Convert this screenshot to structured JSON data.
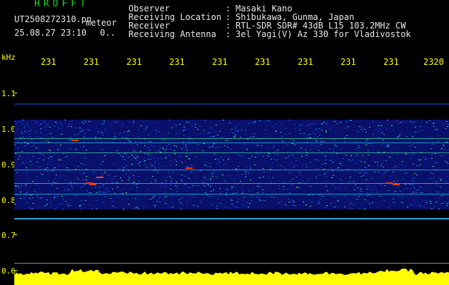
{
  "header": {
    "brand": "HROFFT",
    "filename": "UT2508272310.pn",
    "mode": "meteor",
    "datetime": "25.08.27 23:10",
    "counter": "0..",
    "info_rows": [
      {
        "key": "Observer",
        "value": "Masaki Kano"
      },
      {
        "key": "Receiving Location",
        "value": "Shibukawa, Gunma, Japan"
      },
      {
        "key": "Receiver",
        "value": "RTL-SDR SDR# 43dB L15 103.2MHz CW"
      },
      {
        "key": "Receiving Antenna",
        "value": "3el Yagi(V) Az 330 for Vladivostok"
      }
    ]
  },
  "axis": {
    "y_unit": "kHz",
    "y_ticks": [
      "1.1",
      "1.0",
      "0.9",
      "0.8",
      "0.7",
      "0.6"
    ],
    "x_ticks": [
      "231",
      "231",
      "231",
      "231",
      "231",
      "231",
      "231",
      "231",
      "231",
      "2320"
    ]
  },
  "colors": {
    "background": "#000000",
    "brand": "#21d321",
    "labels": "#ffff00",
    "text": "#e8e8e8",
    "signal_band": "#1a3ad0",
    "hot": "#ff3a00",
    "histogram": "#ffff00"
  }
}
